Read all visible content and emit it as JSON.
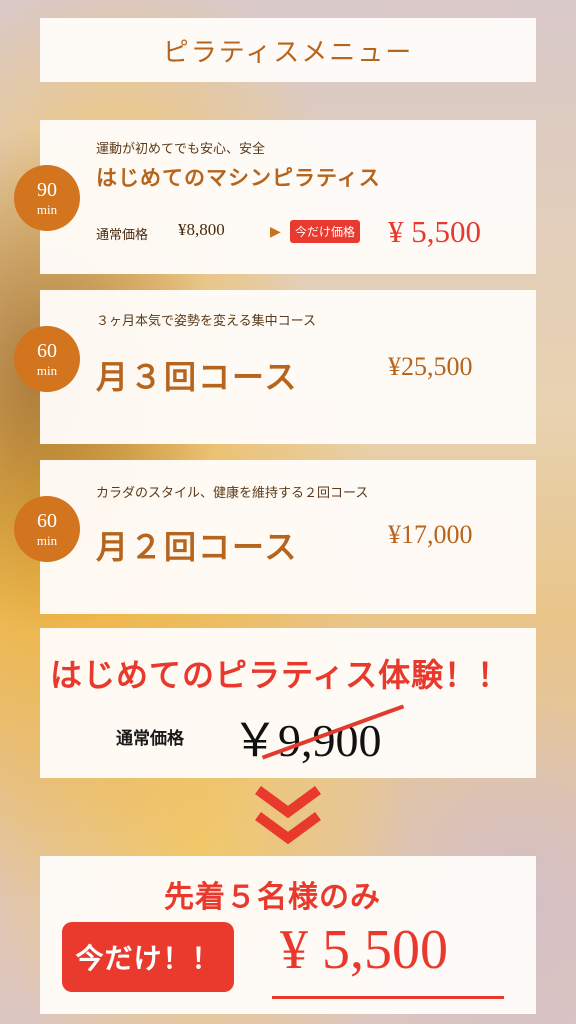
{
  "title": "ピラティスメニュー",
  "menu": [
    {
      "badge_number": "90",
      "badge_unit": "min",
      "subtitle": "運動が初めてでも安心、安全",
      "name": "はじめてのマシンピラティス",
      "regular_label": "通常価格",
      "regular_price": "¥8,800",
      "arrow": "▶",
      "today_label": "今だけ価格",
      "sale_price": "¥ 5,500"
    },
    {
      "badge_number": "60",
      "badge_unit": "min",
      "subtitle": "３ヶ月本気で姿勢を変える集中コース",
      "name": "月３回コース",
      "price": "¥25,500"
    },
    {
      "badge_number": "60",
      "badge_unit": "min",
      "subtitle": "カラダのスタイル、健康を維持する２回コース",
      "name": "月２回コース",
      "price": "¥17,000"
    }
  ],
  "trial": {
    "heading": "はじめてのピラティス体験！！",
    "regular_label": "通常価格",
    "regular_price": "￥9,900"
  },
  "chevron_icon": "double-chevron-down-icon",
  "final": {
    "heading": "先着５名様のみ",
    "today_button": "今だけ！！",
    "price": "¥ 5,500"
  },
  "colors": {
    "accent_orange": "#d3741e",
    "text_brown": "#b5651d",
    "sale_red": "#e8392c"
  }
}
